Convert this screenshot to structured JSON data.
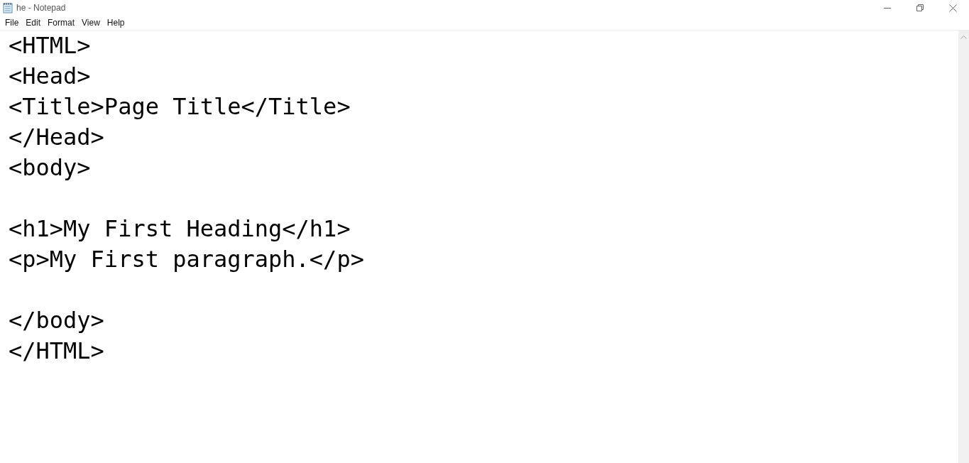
{
  "window": {
    "title": "he - Notepad"
  },
  "menu": [
    "File",
    "Edit",
    "Format",
    "View",
    "Help"
  ],
  "document": {
    "text": "<HTML>\n<Head>\n<Title>Page Title</Title>\n</Head>\n<body>\n\n<h1>My First Heading</h1>\n<p>My First paragraph.</p>\n\n</body>\n</HTML>"
  }
}
